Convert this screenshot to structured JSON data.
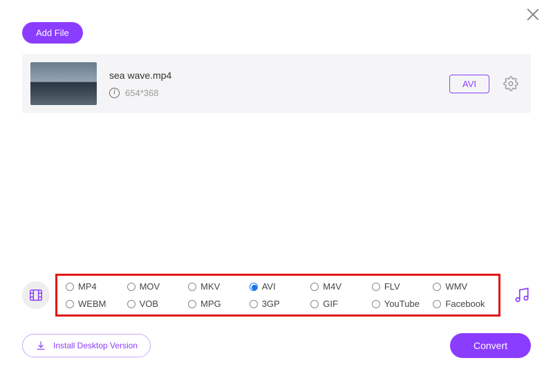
{
  "buttons": {
    "add_file": "Add File",
    "install_desktop": "Install Desktop Version",
    "convert": "Convert"
  },
  "file": {
    "name": "sea wave.mp4",
    "dimensions": "654*368",
    "selected_format": "AVI"
  },
  "formats": {
    "selected": "AVI",
    "row1": [
      "MP4",
      "MOV",
      "MKV",
      "AVI",
      "M4V",
      "FLV",
      "WMV"
    ],
    "row2": [
      "WEBM",
      "VOB",
      "MPG",
      "3GP",
      "GIF",
      "YouTube",
      "Facebook"
    ]
  },
  "colors": {
    "accent": "#8b3dff",
    "highlight_border": "#e11717",
    "radio_selected": "#1a73e8"
  }
}
